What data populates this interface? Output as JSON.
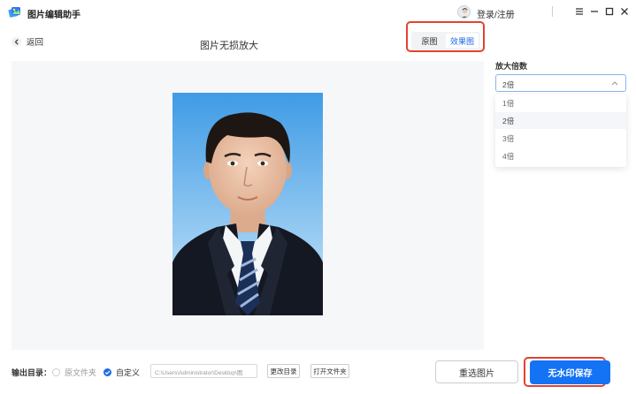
{
  "app": {
    "title": "图片编辑助手",
    "login_label": "登录/注册"
  },
  "nav": {
    "back_label": "返回",
    "page_title": "图片无损放大"
  },
  "view_toggle": {
    "original_label": "原图",
    "effect_label": "效果图",
    "active": "效果图"
  },
  "sidebar": {
    "scale_label": "放大倍数",
    "selected_value": "2倍",
    "options": [
      "1倍",
      "2倍",
      "3倍",
      "4倍"
    ]
  },
  "footer": {
    "output_label": "输出目录：",
    "radio_original": "原文件夹",
    "radio_custom": "自定义",
    "path_value": "C:\\Users\\Administrator\\Desktop\\图",
    "change_dir_label": "更改目录",
    "open_folder_label": "打开文件夹"
  },
  "actions": {
    "reselect_label": "重选图片",
    "save_label": "无水印保存"
  },
  "colors": {
    "accent": "#1473f5",
    "highlight": "#e2432f"
  },
  "icons": {
    "app": "app-logo-icon",
    "back": "chevron-left-icon",
    "select": "chevron-up-icon",
    "user": "user-avatar-icon",
    "window": [
      "minimize-icon",
      "maximize-icon",
      "close-icon"
    ],
    "menu": "menu-icon"
  }
}
